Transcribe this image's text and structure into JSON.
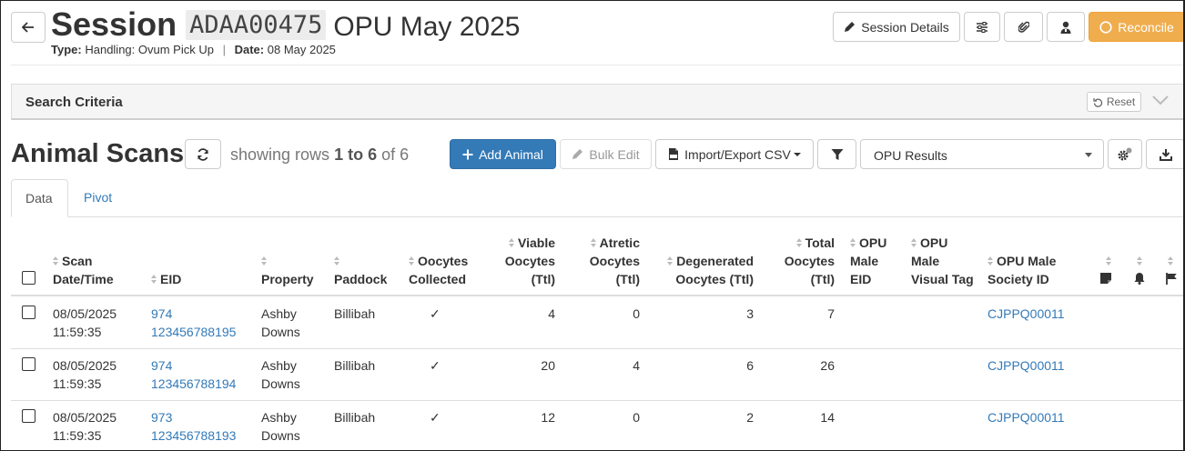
{
  "header": {
    "title_main": "Session",
    "session_code": "ADAA00475",
    "title_suffix": "OPU May 2025",
    "type_label": "Type:",
    "type_value": "Handling: Ovum Pick Up",
    "separator": "|",
    "date_label": "Date:",
    "date_value": "08 May 2025",
    "session_details_label": "Session Details",
    "reconcile_label": "Reconcile"
  },
  "search": {
    "label": "Search Criteria",
    "reset_label": "Reset"
  },
  "scans": {
    "title": "Animal Scans",
    "rows_prefix": "showing rows",
    "rows_range": "1 to 6",
    "rows_of": "of 6",
    "add_animal_label": "Add Animal",
    "bulk_edit_label": "Bulk Edit",
    "import_export_label": "Import/Export CSV",
    "view_select_value": "OPU Results"
  },
  "tabs": [
    {
      "label": "Data"
    },
    {
      "label": "Pivot"
    }
  ],
  "table": {
    "columns": {
      "scan_datetime": [
        "Scan",
        "Date/Time"
      ],
      "eid": "EID",
      "property": "Property",
      "paddock": "Paddock",
      "oocytes_collected": [
        "Oocytes",
        "Collected"
      ],
      "viable": [
        "Viable",
        "Oocytes",
        "(Ttl)"
      ],
      "atretic": [
        "Atretic",
        "Oocytes",
        "(Ttl)"
      ],
      "degenerated": [
        "Degenerated",
        "Oocytes (Ttl)"
      ],
      "total": [
        "Total",
        "Oocytes",
        "(Ttl)"
      ],
      "opu_male_eid": [
        "OPU",
        "Male",
        "EID"
      ],
      "opu_male_visual": [
        "OPU",
        "Male",
        "Visual Tag"
      ],
      "opu_male_society": [
        "OPU Male",
        "Society ID"
      ]
    },
    "rows": [
      {
        "date": "08/05/2025",
        "time": "11:59:35",
        "eid_1": "974",
        "eid_2": "123456788195",
        "property_1": "Ashby",
        "property_2": "Downs",
        "paddock": "Billibah",
        "collected": "✓",
        "viable": "4",
        "atretic": "0",
        "degenerated": "3",
        "total": "7",
        "society_id": "CJPPQ00011"
      },
      {
        "date": "08/05/2025",
        "time": "11:59:35",
        "eid_1": "974",
        "eid_2": "123456788194",
        "property_1": "Ashby",
        "property_2": "Downs",
        "paddock": "Billibah",
        "collected": "✓",
        "viable": "20",
        "atretic": "4",
        "degenerated": "6",
        "total": "26",
        "society_id": "CJPPQ00011"
      },
      {
        "date": "08/05/2025",
        "time": "11:59:35",
        "eid_1": "973",
        "eid_2": "123456788193",
        "property_1": "Ashby",
        "property_2": "Downs",
        "paddock": "Billibah",
        "collected": "✓",
        "viable": "12",
        "atretic": "0",
        "degenerated": "2",
        "total": "14",
        "society_id": "CJPPQ00011"
      }
    ]
  },
  "colors": {
    "primary": "#337ab7",
    "reconcile": "#f0ad4e",
    "link": "#337ab7"
  },
  "icons": [
    "back-arrow-icon",
    "pencil-icon",
    "sliders-icon",
    "paperclip-icon",
    "user-icon",
    "circle-icon",
    "undo-icon",
    "chevron-down-icon",
    "refresh-icon",
    "plus-icon",
    "csv-file-icon",
    "filter-icon",
    "gear-icon",
    "download-icon",
    "note-icon",
    "bell-icon",
    "flag-icon"
  ]
}
